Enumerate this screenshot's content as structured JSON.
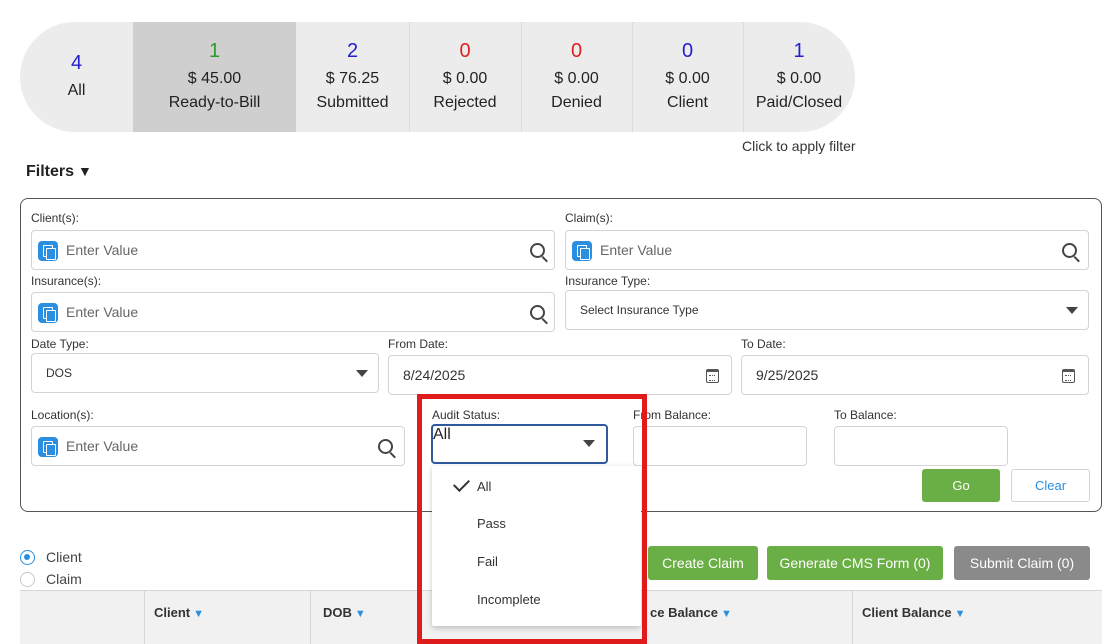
{
  "status_tiles": [
    {
      "count": "4",
      "amount": "",
      "label": "All"
    },
    {
      "count": "1",
      "amount": "$ 45.00",
      "label": "Ready-to-Bill"
    },
    {
      "count": "2",
      "amount": "$ 76.25",
      "label": "Submitted"
    },
    {
      "count": "0",
      "amount": "$ 0.00",
      "label": "Rejected"
    },
    {
      "count": "0",
      "amount": "$ 0.00",
      "label": "Denied"
    },
    {
      "count": "0",
      "amount": "$ 0.00",
      "label": "Client"
    },
    {
      "count": "1",
      "amount": "$ 0.00",
      "label": "Paid/Closed"
    }
  ],
  "status_hint": "Click to apply filter",
  "filters": {
    "title": "Filters",
    "clients": {
      "label": "Client(s):",
      "placeholder": "Enter Value"
    },
    "claims": {
      "label": "Claim(s):",
      "placeholder": "Enter Value"
    },
    "insurances": {
      "label": "Insurance(s):",
      "placeholder": "Enter Value"
    },
    "insurance_type": {
      "label": "Insurance Type:",
      "value": "Select Insurance Type"
    },
    "date_type": {
      "label": "Date Type:",
      "value": "DOS"
    },
    "from_date": {
      "label": "From Date:",
      "value": "8/24/2025"
    },
    "to_date": {
      "label": "To Date:",
      "value": "9/25/2025"
    },
    "locations": {
      "label": "Location(s):",
      "placeholder": "Enter Value"
    },
    "audit_status": {
      "label": "Audit Status:",
      "value": "All",
      "options": [
        "All",
        "Pass",
        "Fail",
        "Incomplete"
      ],
      "selected": "All"
    },
    "from_balance": {
      "label": "From Balance:"
    },
    "to_balance": {
      "label": "To Balance:"
    },
    "go_label": "Go",
    "clear_label": "Clear"
  },
  "view_mode": {
    "options": [
      "Client",
      "Claim"
    ],
    "selected": "Client"
  },
  "actions": {
    "create_claim": "Create Claim",
    "generate_cms": "Generate CMS Form (0)",
    "submit_claim": "Submit Claim (0)"
  },
  "table": {
    "columns": [
      "Client",
      "DOB",
      "Balance",
      "Client Balance"
    ],
    "partial_column_visible": "ce Balance"
  },
  "colors": {
    "accent_blue": "#2a8fe0",
    "go_green": "#6aaf45",
    "action_green": "#6aaf45",
    "submit_gray": "#8a8a8a",
    "highlight_red": "#e01b1b",
    "count_blue": "#2222cc",
    "count_green": "#2e9a2e",
    "count_red": "#e02020"
  }
}
